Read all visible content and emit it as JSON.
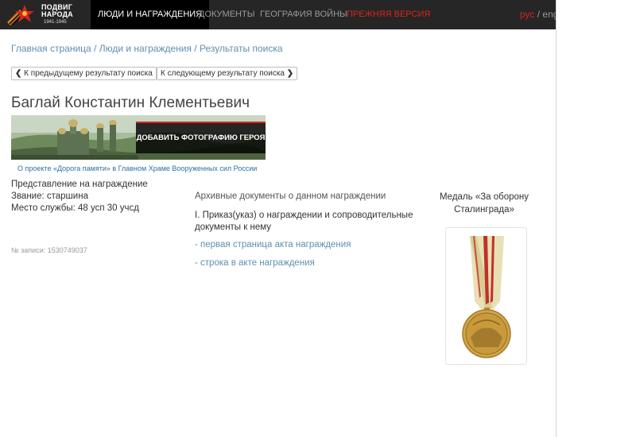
{
  "logo": {
    "line1": "ПОДВИГ",
    "line2": "НАРОДА",
    "years": "1941-1945"
  },
  "nav": {
    "people": "ЛЮДИ И НАГРАЖДЕНИЯ",
    "docs": "ДОКУМЕНТЫ",
    "geo": "ГЕОГРАФИЯ ВОЙНЫ",
    "old": "ПРЕЖНЯЯ ВЕРСИЯ",
    "lang_ru": "рус",
    "lang_sep": " / ",
    "lang_en": "eng"
  },
  "breadcrumb": "Главная страница / Люди и награждения / Результаты поиска",
  "pager": {
    "prev": "К предыдущему результату поиска",
    "next": "К следующему результату поиска"
  },
  "person": {
    "name": "Баглай Константин Клементьевич",
    "type": "Представление на награждение",
    "rank": "Звание: старшина",
    "place": "Место службы: 48 усп 30 учсд",
    "record": "№ записи: 1530749037"
  },
  "banner": {
    "cta": "ДОБАВИТЬ ФОТОГРАФИЮ ГЕРОЯ",
    "link": "О проекте «Дорога памяти» в Главном Храме Вооруженных сил России"
  },
  "docs": {
    "title": "Архивные документы о данном награждении",
    "order": "I. Приказ(указ) о награждении и сопроводительные документы к нему",
    "link1": "- первая страница акта награждения",
    "link2": "- строка в акте награждения"
  },
  "medal": {
    "name": "Медаль «За оборону Сталинграда»"
  },
  "colors": {
    "nav_bg": "#262626",
    "accent_red": "#d9241b",
    "link": "#5f8fb0"
  }
}
